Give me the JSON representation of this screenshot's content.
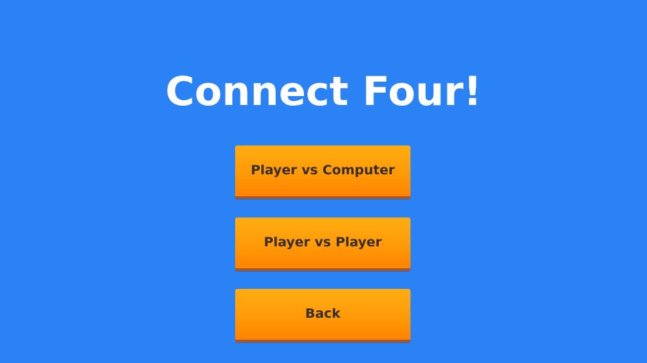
{
  "screen": {
    "title": "Connect Four!",
    "background_color": "#2a82f5",
    "accent_color": "#ff9a08"
  },
  "menu": {
    "buttons": [
      {
        "label": "Player vs Computer"
      },
      {
        "label": "Player vs Player"
      },
      {
        "label": "Back"
      }
    ]
  }
}
